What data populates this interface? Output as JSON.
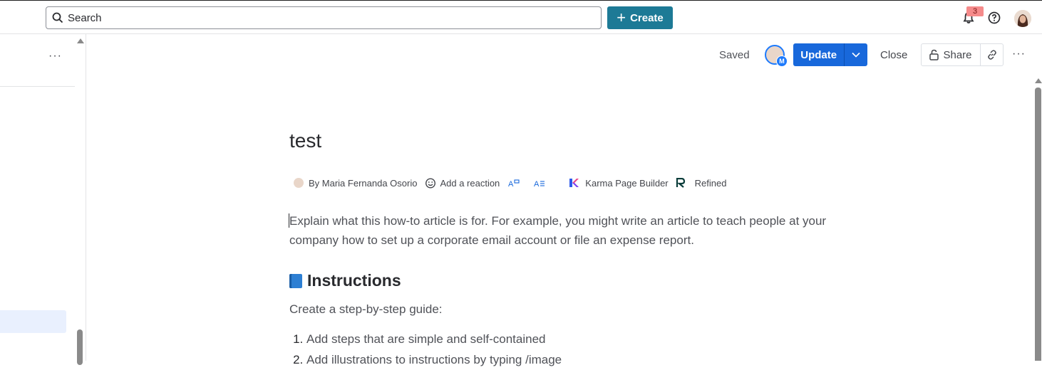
{
  "topbar": {
    "search_placeholder": "Search",
    "create_label": "Create",
    "notification_count": "3"
  },
  "toolbar": {
    "status": "Saved",
    "editor_initial": "M",
    "update_label": "Update",
    "close_label": "Close",
    "share_label": "Share"
  },
  "page": {
    "title": "test",
    "byline": {
      "author": "By Maria Fernanda Osorio",
      "reaction": "Add a reaction",
      "app1": "Karma Page Builder",
      "app2": "Refined"
    },
    "intro": "Explain what this how-to article is for. For example, you might write an article to teach people at your company how to set up a corporate email account or file an expense report.",
    "heading": "Instructions",
    "sub": "Create a step-by-step guide:",
    "steps": [
      "Add steps that are simple and self-contained",
      "Add illustrations to instructions by typing /image"
    ]
  },
  "icons": {
    "search": "search-icon",
    "plus": "plus-icon",
    "bell": "bell-icon",
    "help": "help-icon",
    "lock": "lock-icon",
    "link": "link-icon",
    "more": "more-icon",
    "book": "book-icon"
  },
  "colors": {
    "create_bg": "#1d7a96",
    "update_bg": "#1868db",
    "badge_bg": "#f58b8b",
    "selected_bg": "#e9f0fe"
  }
}
